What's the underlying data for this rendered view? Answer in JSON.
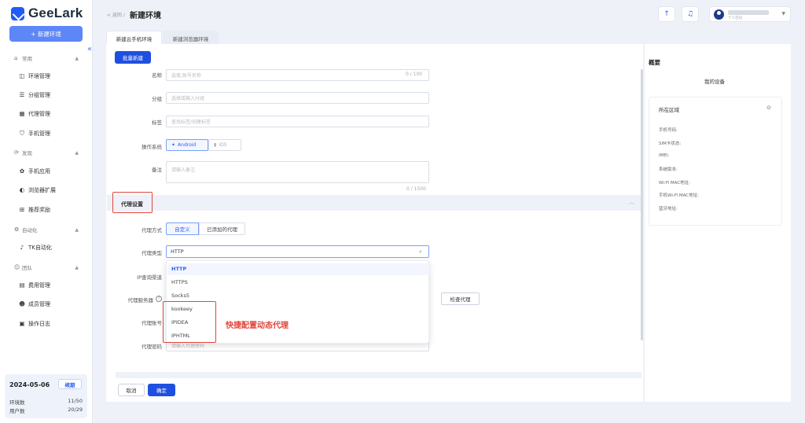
{
  "app": {
    "name": "GeeLark"
  },
  "sidebar": {
    "new_env_label": "+ 新建环境",
    "collapse_glyph": "«",
    "sections": [
      {
        "label": "常用",
        "items": [
          "环境管理",
          "分组管理",
          "代理管理",
          "手机管理"
        ]
      },
      {
        "label": "发现",
        "items": [
          "手机应用",
          "浏览器扩展",
          "推荐奖励"
        ]
      },
      {
        "label": "自动化",
        "items": [
          "TK自动化"
        ]
      },
      {
        "label": "团队",
        "items": [
          "费用管理",
          "成员管理",
          "操作日志"
        ]
      }
    ],
    "footer": {
      "date": "2024-05-06",
      "renew_label": "续期",
      "env_count_label": "环境数",
      "env_count_value": "11/50",
      "user_count_label": "用户数",
      "user_count_value": "20/29"
    }
  },
  "header": {
    "back_label": "< 返回 /",
    "title": "新建环境",
    "user_sub": "个人空间"
  },
  "tabs": [
    "新建云手机环境",
    "新建浏览器环境"
  ],
  "form": {
    "batch_label": "批量新建",
    "name_label": "名称",
    "name_placeholder": "选填,账号名称",
    "name_counter": "0 / 100",
    "group_label": "分组",
    "group_placeholder": "选择或输入分组",
    "tag_label": "标签",
    "tag_placeholder": "查找标签/创建标签",
    "os_label": "操作系统",
    "os_android": "Android",
    "os_ios": "iOS",
    "remark_label": "备注",
    "remark_placeholder": "请输入备注",
    "remark_counter": "0 / 1500"
  },
  "proxy": {
    "section_title": "代理设置",
    "mode_label": "代理方式",
    "mode_custom": "自定义",
    "mode_added": "已添加的代理",
    "type_label": "代理类型",
    "type_value": "HTTP",
    "ip_label": "IP查询渠道",
    "server_label": "代理服务器",
    "check_label": "检查代理",
    "account_label": "代理账号",
    "password_label": "代理密码",
    "password_placeholder": "请输入代理密码",
    "options": [
      "HTTP",
      "HTTPS",
      "Socks5",
      "kookeey",
      "IPIDEA",
      "IPHTML"
    ],
    "annotation": "快捷配置动态代理"
  },
  "actions": {
    "cancel": "取消",
    "confirm": "确定"
  },
  "overview": {
    "title": "概要",
    "my_device": "我的设备",
    "region_label": "所在区域",
    "fields": [
      "手机号码:",
      "SIM卡状态:",
      "IMEI:",
      "系统版本:",
      "Wi-Fi MAC地址:",
      "手机Wi-Fi MAC地址:",
      "蓝牙地址:"
    ]
  },
  "colors": {
    "primary": "#1f4fe0",
    "accent": "#2d5cf6",
    "highlight": "#e2463c"
  },
  "icons": {
    "upload": "upload-icon",
    "bell": "bell-icon",
    "pin": "location-icon",
    "search": "search-icon"
  }
}
